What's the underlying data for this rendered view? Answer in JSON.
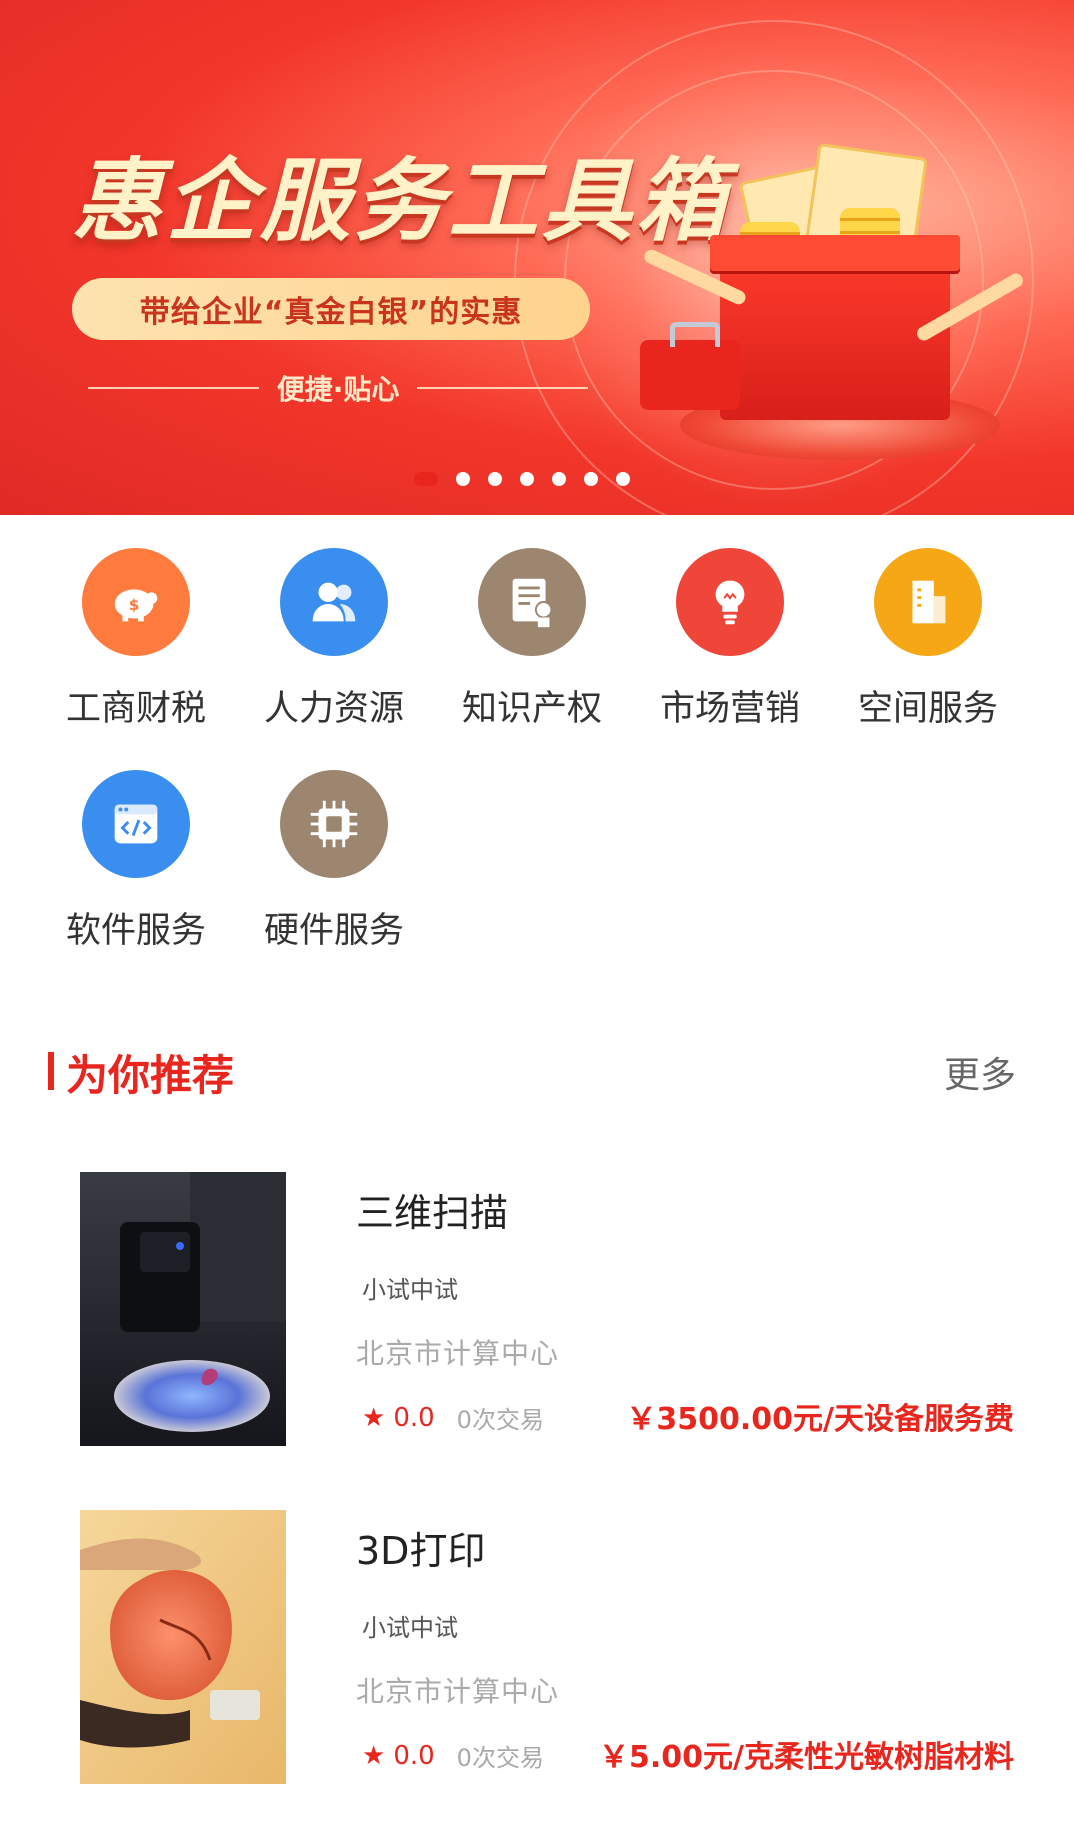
{
  "banner": {
    "title": "惠企服务工具箱",
    "slogan": "带给企业“真金白银”的实惠",
    "subtitle": "便捷·贴心",
    "dot_count": 7,
    "active_dot": 0
  },
  "categories": [
    {
      "label": "工商财税",
      "icon": "piggy-bank-icon",
      "color": "#ff7a3d"
    },
    {
      "label": "人力资源",
      "icon": "users-icon",
      "color": "#3a8ef0"
    },
    {
      "label": "知识产权",
      "icon": "certificate-icon",
      "color": "#9c8670"
    },
    {
      "label": "市场营销",
      "icon": "lightbulb-icon",
      "color": "#f0463a"
    },
    {
      "label": "空间服务",
      "icon": "building-icon",
      "color": "#f5a716"
    },
    {
      "label": "软件服务",
      "icon": "code-window-icon",
      "color": "#3a8ef0"
    },
    {
      "label": "硬件服务",
      "icon": "chip-icon",
      "color": "#9c8670"
    }
  ],
  "recommend": {
    "title": "为你推荐",
    "more": "更多"
  },
  "items": [
    {
      "name": "三维扫描",
      "tag": "小试中试",
      "org": "北京市计算中心",
      "score": "0.0",
      "trades": "0次交易",
      "price": "￥3500.00元/天设备服务费"
    },
    {
      "name": "3D打印",
      "tag": "小试中试",
      "org": "北京市计算中心",
      "score": "0.0",
      "trades": "0次交易",
      "price": "￥5.00元/克柔性光敏树脂材料"
    }
  ],
  "colors": {
    "accent": "#e8261e"
  }
}
